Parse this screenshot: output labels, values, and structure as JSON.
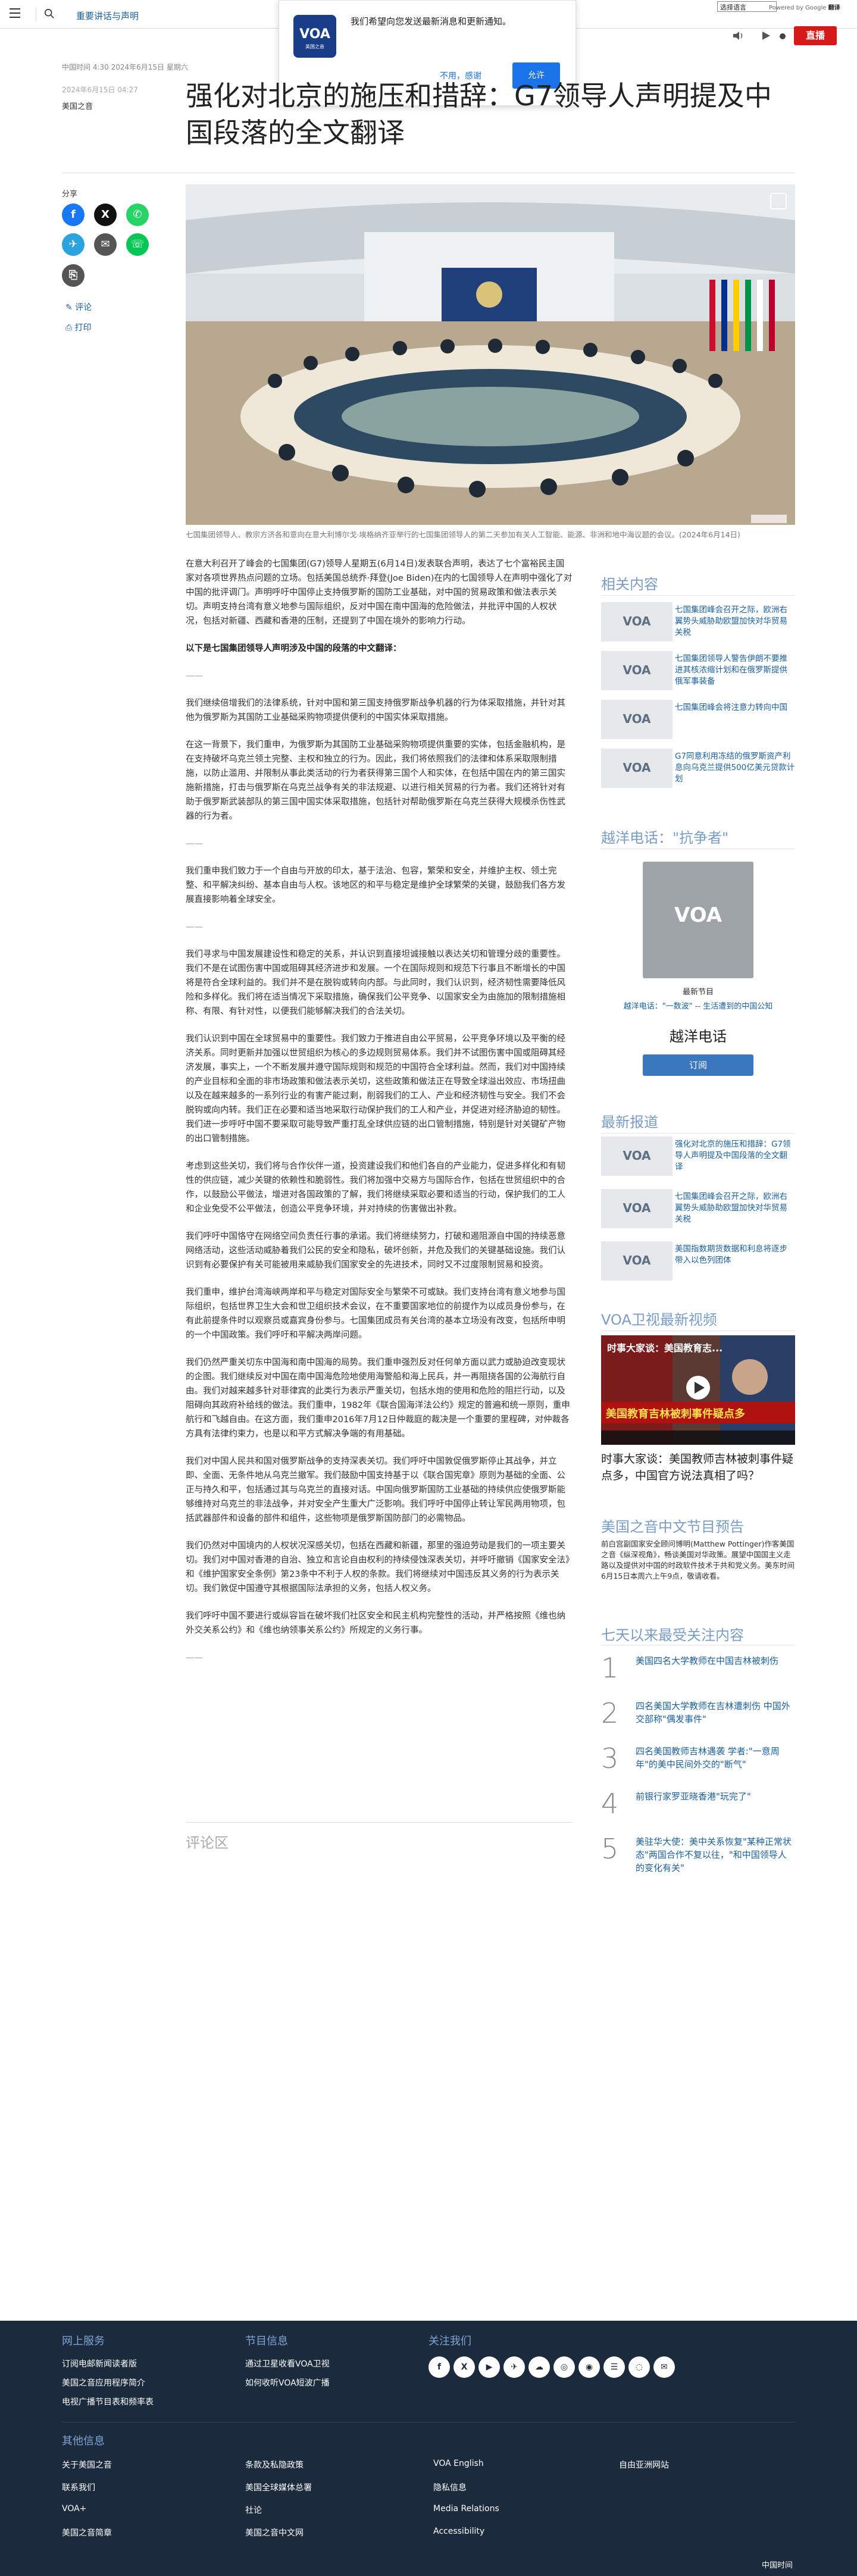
{
  "header": {
    "site_name": "重要讲话与声明",
    "language_select": "选择语言",
    "google_translate_prefix": "Powered by Google",
    "google_translate_label": "翻译",
    "live_label": "直播"
  },
  "notification": {
    "message": "我们希望向您发送最新消息和更新通知。",
    "deny_label": "不用，感谢",
    "allow_label": "允许",
    "logo_text": "VOA",
    "logo_sub": "美国之音"
  },
  "article": {
    "time_label": "中国时间 4:30 2024年6月15日 星期六",
    "date_label": "2024年6月15日 04:27",
    "category": "美国之音",
    "title": "强化对北京的施压和措辞：G7领导人声明提及中国段落的全文翻译",
    "share_label": "分享",
    "comments_link": "评论",
    "print_link": "打印",
    "image_caption": "七国集团领导人、教宗方济各和意向在意大利博尔戈·埃格纳齐亚举行的七国集团领导人的第二天参加有关人工智能、能源、非洲和地中海议题的会议。(2024年6月14日)",
    "paragraphs": [
      "在意大利召开了峰会的七国集团(G7)领导人星期五(6月14日)发表联合声明，表达了七个富裕民主国家对各项世界热点问题的立场。包括美国总统乔·拜登(Joe Biden)在内的七国领导人在声明中强化了对中国的批评调门。声明呼吁中国停止支持俄罗斯的国防工业基础，对中国的贸易政策和做法表示关切。声明支持台湾有意义地参与国际组织，反对中国在南中国海的危险做法，并批评中国的人权状况，包括对新疆、西藏和香港的压制，还提到了中国在境外的影响力行动。",
      "以下是七国集团领导人声明涉及中国的段落的中文翻译：",
      "——",
      "我们继续倍增我们的法律系统，针对中国和第三国支持俄罗斯战争机器的行为体采取措施，并针对其他为俄罗斯为其国防工业基础采购物项提供便利的中国实体采取措施。",
      "在这一背景下，我们重申，为俄罗斯为其国防工业基础采购物项提供重要的实体，包括金融机构，是在支持破坏乌克兰领土完整、主权和独立的行为。因此，我们将依照我们的法律和体系采取限制措施，以防止滥用、并限制从事此类活动的行为者获得第三国个人和实体，在包括中国在内的第三国实施新措施，打击与俄罗斯在乌克兰战争有关的非法规避、以进行相关贸易的行为者。我们还将针对有助于俄罗斯武装部队的第三国中国实体采取措施，包括针对帮助俄罗斯在乌克兰获得大规模杀伤性武器的行为者。",
      "——",
      "我们重申我们致力于一个自由与开放的印太，基于法治、包容，繁荣和安全，并维护主权、领土完整、和平解决纠纷、基本自由与人权。该地区的和平与稳定是维护全球繁荣的关键，鼓励我们各方发展直接影响着全球安全。",
      "——",
      "我们寻求与中国发展建设性和稳定的关系，并认识到直接坦诚接触以表达关切和管理分歧的重要性。我们不是在试图伤害中国或阻碍其经济进步和发展。一个在国际规则和规范下行事且不断增长的中国将是符合全球利益的。我们并不是在脱钩或转向内部。与此同时，我们认识到，经济韧性需要降低风险和多样化。我们将在适当情况下采取措施，确保我们公平竞争、以国家安全为由施加的限制措施相称、有限、有针对性，以便我们能够解决我们的合法关切。",
      "我们认识到中国在全球贸易中的重要性。我们致力于推进自由公平贸易，公平竞争环境以及平衡的经济关系。同时更新并加强以世贸组织为核心的多边规则贸易体系。我们并不试图伤害中国或阻碍其经济发展，事实上，一个不断发展并遵守国际规则和规范的中国符合全球利益。然而，我们对中国持续的产业目标和全面的非市场政策和做法表示关切，这些政策和做法正在导致全球溢出效应、市场扭曲以及在越来越多的一系列行业的有害产能过剩，削弱我们的工人、产业和经济韧性与安全。我们不会脱钩或向内转。我们正在必要和适当地采取行动保护我们的工人和产业，并促进对经济胁迫的韧性。我们进一步呼吁中国不要采取可能导致严重打乱全球供应链的出口管制措施，特别是针对关键矿产物的出口管制措施。",
      "考虑到这些关切，我们将与合作伙伴一道，投资建设我们和他们各自的产业能力，促进多样化和有韧性的供应链，减少关键的依赖性和脆弱性。我们将加强中交易方与国际合作，包括在世贸组织中的合作，以鼓励公平做法，增进对各国政策的了解，我们将继续采取必要和适当的行动，保护我们的工人和企业免受不公平做法，创造公平竞争环境，并对持续的伤害做出补救。",
      "我们呼吁中国恪守在网络空间负责任行事的承诺。我们将继续努力，打破和遏阻源自中国的持续恶意网络活动，这些活动威胁着我们公民的安全和隐私，破坏创新，并危及我们的关键基础设施。我们认识到有必要保护有关可能被用来威胁我们国家安全的先进技术，同时又不过度限制贸易和投资。",
      "我们重申，维护台湾海峡两岸和平与稳定对国际安全与繁荣不可或缺。我们支持台湾有意义地参与国际组织，包括世界卫生大会和世卫组织技术会议，在不重要国家地位的前提作为以成员身份参与，在有此前提条件时以观察员或嘉宾身份参与。七国集团成员有关台湾的基本立场没有改变，包括所申明的一个中国政策。我们呼吁和平解决两岸问题。",
      "我们仍然严重关切东中国海和南中国海的局势。我们重申强烈反对任何单方面以武力或胁迫改变现状的企图。我们继续反对中国在南中国海危险地使用海警船和海上民兵，并一再阻挠各国的公海航行自由。我们对越来越多针对菲律宾的此类行为表示严重关切，包括水炮的使用和危险的阻拦行动，以及阻碍向其政府补给线的做法。我们重申，1982年《联合国海洋法公约》规定的普遍和统一原则，重申航行和飞越自由。在这方面，我们重申2016年7月12日仲裁庭的裁决是一个重要的里程碑，对仲裁各方具有法律约束力，也是以和平方式解决争端的有用基础。",
      "我们对中国人民共和国对俄罗斯战争的支持深表关切。我们呼吁中国敦促俄罗斯停止其战争，并立即、全面、无条件地从乌克兰撤军。我们鼓励中国支持基于以《联合国宪章》原则为基础的全面、公正与持久和平，包括通过其与乌克兰的直接对话。中国向俄罗斯国防工业基础的持续供应使俄罗斯能够维持对乌克兰的非法战争，并对安全产生重大广泛影响。我们呼吁中国停止转让军民两用物项，包括武器部件和设备的部件和组件，这些物项是俄罗斯国防部门的必需物品。",
      "我们仍然对中国境内的人权状况深感关切，包括在西藏和新疆，那里的强迫劳动是我们的一项主要关切。我们对中国对香港的自治、独立和言论自由权利的持续侵蚀深表关切，并呼吁撤销《国家安全法》和《维护国家安全条例》第23条中不利于人权的条款。我们将继续对中国违反其义务的行为表示关切。我们敦促中国遵守其根据国际法承担的义务，包括人权义务。",
      "我们呼吁中国不要进行或纵容旨在破坏我们社区安全和民主机构完整性的活动，并严格按照《维也纳外交关系公约》和《维也纳领事关系公约》所规定的义务行事。",
      "——"
    ],
    "comments_heading": "评论区"
  },
  "related": {
    "heading": "相关内容",
    "items": [
      {
        "thumb": "VOA",
        "text": "七国集团峰会召开之际，欧洲右翼势头威胁助欧盟加快对华贸易关税"
      },
      {
        "thumb": "VOA",
        "text": "七国集团领导人警告伊朗不要推进其核浓缩计划和在俄罗斯提供俄军事装备"
      },
      {
        "thumb": "VOA",
        "text": "七国集团峰会将注意力转向中国"
      },
      {
        "thumb": "VOA",
        "text": "G7同意利用冻结的俄罗斯资产利息向乌克兰提供500亿美元贷款计划"
      }
    ]
  },
  "podcast": {
    "heading": "越洋电话：\"抗争者\"",
    "thumb": "VOA",
    "episode": "最新节目",
    "description": "越洋电话：\"一数波\" -- 生活遭到的中国公知",
    "name": "越洋电话",
    "subscribe_label": "订阅"
  },
  "latest": {
    "heading": "最新报道",
    "items": [
      {
        "thumb": "VOA",
        "text": "强化对北京的施压和措辞：G7领导人声明提及中国段落的全文翻译"
      },
      {
        "thumb": "VOA",
        "text": "七国集团峰会召开之际，欧洲右翼势头威胁助欧盟加快对华贸易关税"
      },
      {
        "thumb": "VOA",
        "text": "美国指数期货数据和利息将逐步带入以色列团体"
      }
    ]
  },
  "video": {
    "heading": "VOA卫视最新视频",
    "overlay_title": "时事大家谈：美国教育志...",
    "banner": "美国教育吉林被刺事件疑点多",
    "caption": "时事大家谈：美国教师吉林被刺事件疑点多，中国官方说法真相了吗？"
  },
  "program": {
    "heading": "美国之音中文节目预告",
    "description": "前白宫副国家安全顾问博明(Matthew Pottinger)作客美国之音《纵深视角》，畅谈美国对华政策。展望中国国主义走路以及提供对中国的时政软件技术于共和党义务。美东时间6月15日本周六上午9点，敬请收看。"
  },
  "top": {
    "heading": "七天以来最受关注内容",
    "items": [
      {
        "num": "1",
        "text": "美国四名大学教师在中国吉林被刺伤"
      },
      {
        "num": "2",
        "text": "四名美国大学教师在吉林遭刺伤 中国外交部称\"偶发事件\""
      },
      {
        "num": "3",
        "text": "四名美国教师吉林遇袭 学者:\"一意周年\"的美中民间外交的\"断气\""
      },
      {
        "num": "4",
        "text": "前银行家罗亚晓香港\"玩完了\""
      },
      {
        "num": "5",
        "text": "美驻华大使：美中关系恢复\"某种正常状态\"两国合作不复以往，\"和中国领导人的变化有关\""
      }
    ]
  },
  "footer": {
    "col1_heading": "网上服务",
    "col1_links": [
      "订阅电邮新闻读者版",
      "美国之音应用程序简介",
      "电视广播节目表和频率表"
    ],
    "col2_heading": "节目信息",
    "col2_links": [
      "通过卫星收看VOA卫视",
      "如何收听VOA短波广播"
    ],
    "col3_heading": "关注我们",
    "social": [
      "f",
      "X",
      "▶",
      "✈",
      "☁",
      "◎",
      "◉",
      "☰",
      "◌",
      "✉"
    ],
    "other_heading": "其他信息",
    "other_links": [
      [
        "关于美国之音",
        "条款及私隐政策",
        "VOA English",
        "自由亚洲网站"
      ],
      [
        "联系我们",
        "美国全球媒体总署",
        "隐私信息",
        ""
      ],
      [
        "VOA+",
        "社论",
        "Media Relations",
        ""
      ],
      [
        "美国之音简章",
        "美国之音中文网",
        "Accessibility",
        ""
      ]
    ],
    "copyright": "中国时间"
  }
}
